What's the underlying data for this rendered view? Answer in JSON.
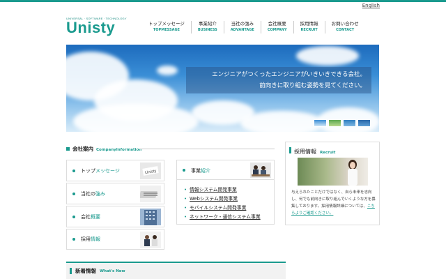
{
  "header": {
    "lang_link": "English",
    "logo_tagline": "UNIVERSAL · SOFTWARE · TECHNOLOGY",
    "logo_name": "Unisty",
    "nav": [
      {
        "jp": "トップメッセージ",
        "en": "TOPMESSAGE"
      },
      {
        "jp": "事業紹介",
        "en": "BUSINESS"
      },
      {
        "jp": "当社の強み",
        "en": "ADVANTAGE"
      },
      {
        "jp": "会社概要",
        "en": "COMPANY"
      },
      {
        "jp": "採用情報",
        "en": "RECRUIT"
      },
      {
        "jp": "お問い合わせ",
        "en": "CONTACT"
      }
    ]
  },
  "hero": {
    "line1": "エンジニアがつくったエンジニアがいきいきできる会社。",
    "line2": "前向きに取り組む姿勢を見てください。"
  },
  "company": {
    "title_jp": "会社案内",
    "title_en": "CompanyInformation",
    "cards": [
      {
        "pre": "トップ",
        "accent": "メッセージ",
        "post": ""
      },
      {
        "pre": "当社の",
        "accent": "強み",
        "post": ""
      },
      {
        "pre": "会社",
        "accent": "概要",
        "post": ""
      },
      {
        "pre": "採用",
        "accent": "情報",
        "post": ""
      }
    ],
    "business": {
      "pre": "事業",
      "accent": "紹介",
      "items": [
        "情報システム開発事業",
        "Webシステム開発事業",
        "モバイルシステム開発事業",
        "ネットワーク・通信システム事業"
      ]
    }
  },
  "recruit": {
    "title_jp": "採用情報",
    "title_en": "Recruit",
    "text": "与えられたことだけではなく、自ら未来を志向し、何でも前向きに取り組んでいくような方を募集しております。採用情報詳細については、",
    "link": "こちらよりご確認ください。"
  },
  "news": {
    "title_jp": "新着情報",
    "title_en": "What's New"
  },
  "colors": {
    "accent": "#1a9a8e",
    "sky": "#3a8ed6"
  }
}
